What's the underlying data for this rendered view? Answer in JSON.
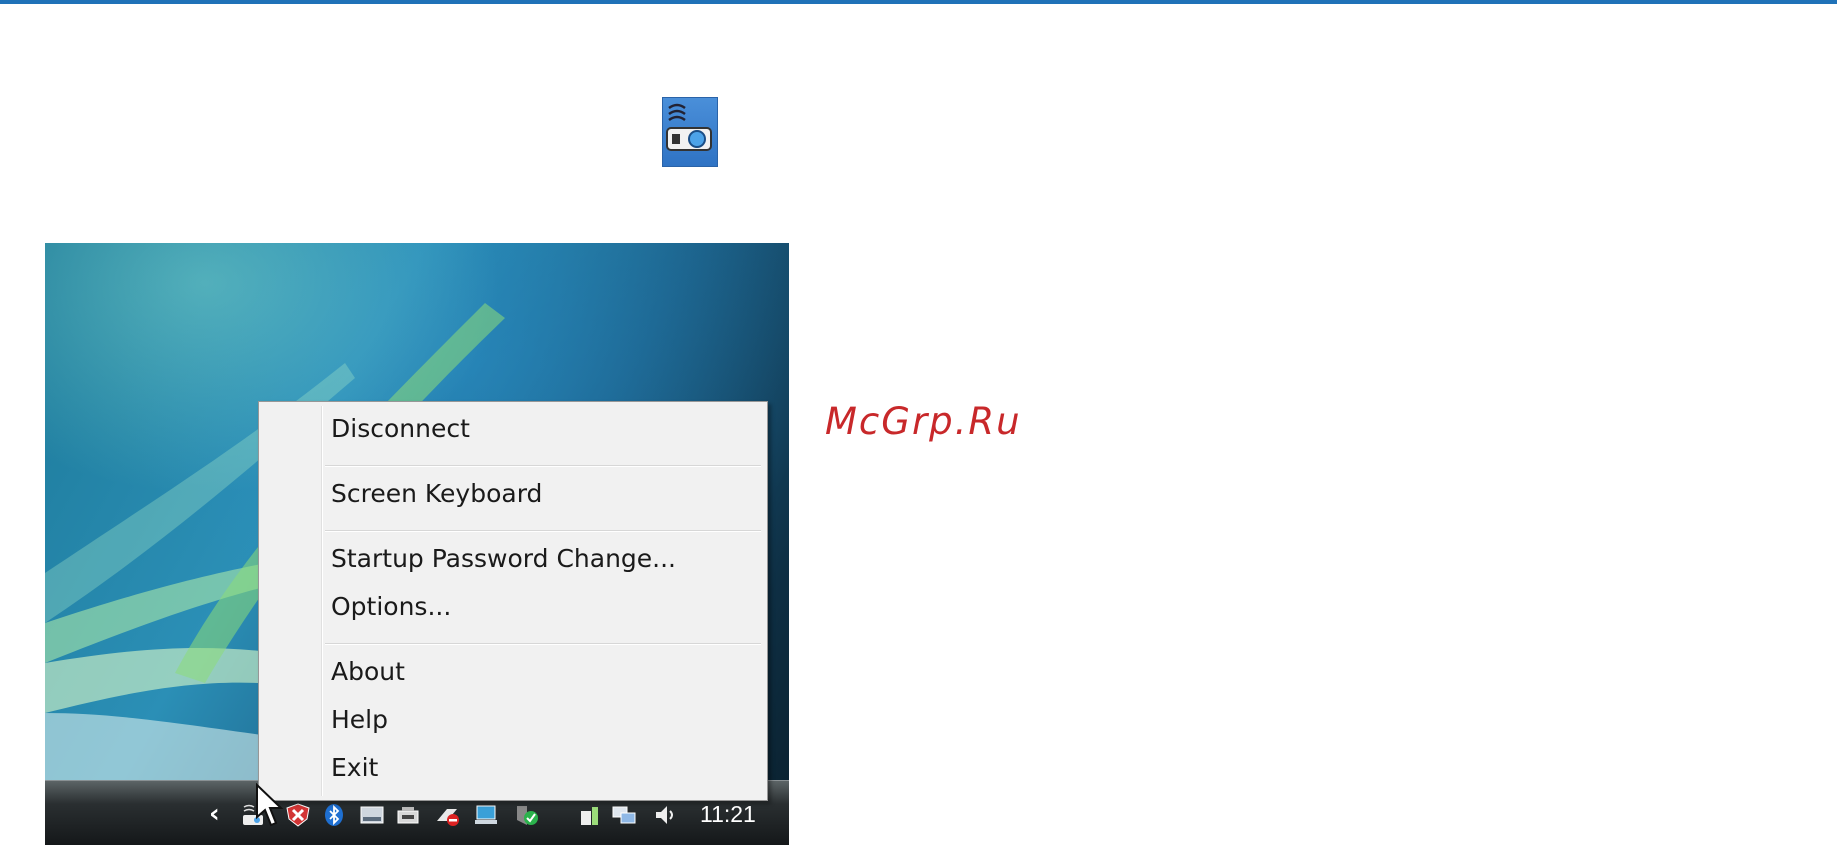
{
  "page": {
    "accent_color": "#1f72b8",
    "watermark": "McGrp.Ru",
    "watermark_color": "#c8282a"
  },
  "app_icon": {
    "icon": "projector-network-icon"
  },
  "screenshot": {
    "context_menu": {
      "items": [
        {
          "label": "Disconnect"
        },
        {
          "label": "Screen Keyboard"
        },
        {
          "label": "Startup Password Change..."
        },
        {
          "label": "Options..."
        },
        {
          "label": "About"
        },
        {
          "label": "Help"
        },
        {
          "label": "Exit"
        }
      ]
    },
    "taskbar": {
      "clock": "11:21",
      "tray_icons": [
        "show-hidden-icons-chevron",
        "projector-network-icon",
        "security-alert-icon",
        "bluetooth-icon",
        "display-icon",
        "device-icon",
        "safely-remove-icon",
        "network-connection-icon",
        "security-shield-icon",
        "power-icon",
        "network-icon",
        "volume-icon"
      ]
    }
  }
}
